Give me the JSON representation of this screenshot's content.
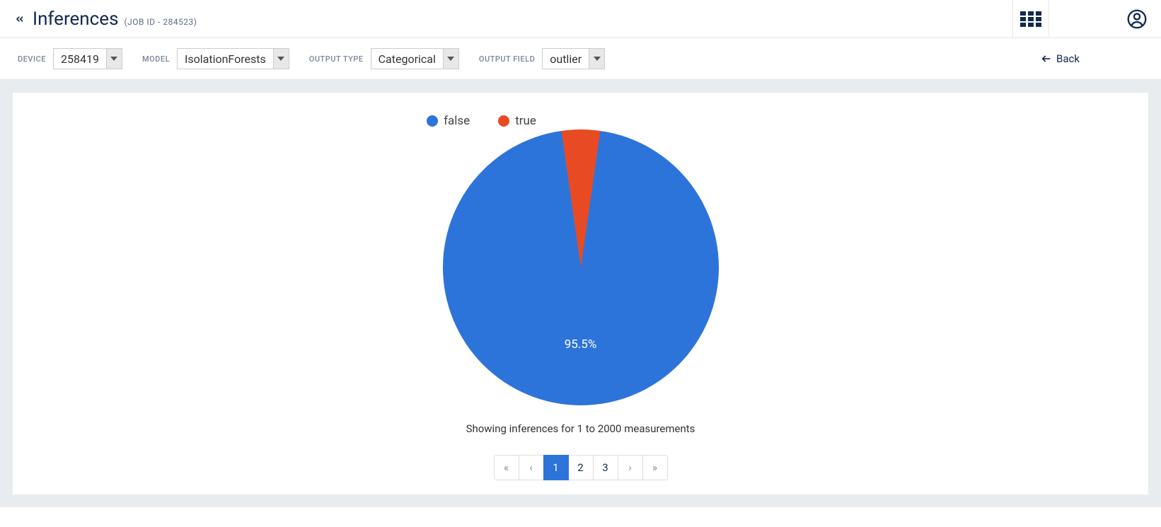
{
  "header": {
    "title": "Inferences",
    "subtitle": "(JOB ID - 284523)"
  },
  "filters": {
    "device": {
      "label": "DEVICE",
      "value": "258419"
    },
    "model": {
      "label": "MODEL",
      "value": "IsolationForests"
    },
    "output_type": {
      "label": "OUTPUT TYPE",
      "value": "Categorical"
    },
    "output_field": {
      "label": "OUTPUT FIELD",
      "value": "outlier"
    },
    "back": "Back"
  },
  "chart_data": {
    "type": "pie",
    "title": "",
    "series": [
      {
        "name": "false",
        "value": 95.5,
        "color": "#2d74da"
      },
      {
        "name": "true",
        "value": 4.5,
        "color": "#e84b24"
      }
    ],
    "data_label": "95.5%"
  },
  "caption": "Showing inferences for 1 to 2000 measurements",
  "pagination": {
    "first": "«",
    "prev": "‹",
    "pages": [
      "1",
      "2",
      "3"
    ],
    "active_index": 0,
    "next": "›",
    "last": "»"
  }
}
